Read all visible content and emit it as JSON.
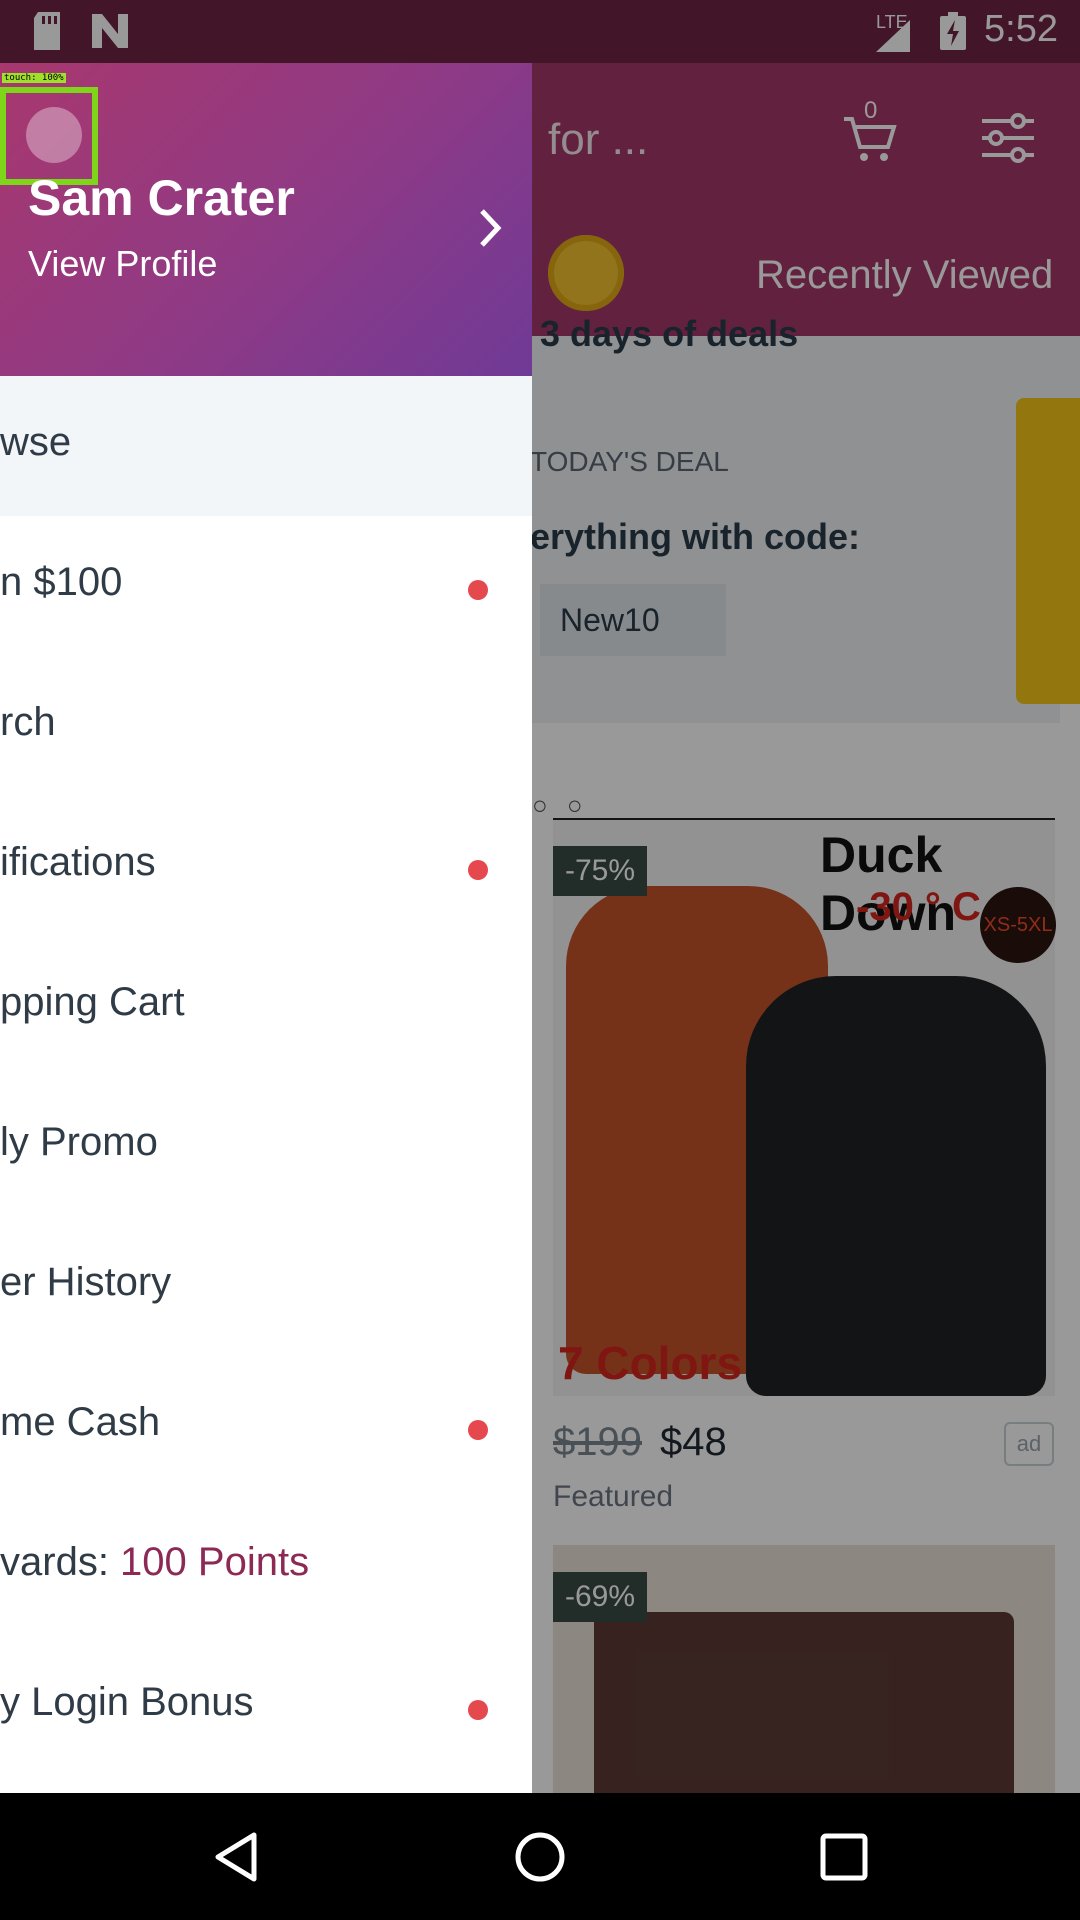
{
  "status_bar": {
    "time": "5:52",
    "network": "LTE"
  },
  "background": {
    "search_placeholder": "for ...",
    "cart_count": "0",
    "recently_viewed": "Recently Viewed",
    "deals_title": "3 days of deals",
    "deal_kicker": "TODAY'S DEAL",
    "deal_text": "erything with code:",
    "deal_code": "New10",
    "product1": {
      "discount": "-75%",
      "brand": "Duck Down",
      "temp": "-30 ° C",
      "size": "XS-5XL",
      "colors": "7 Colors",
      "old_price": "$199",
      "price": "$48",
      "ad": "ad",
      "tag": "Featured"
    },
    "product2": {
      "discount": "-69%"
    }
  },
  "drawer": {
    "user_name": "Sam Crater",
    "view_profile": "View Profile",
    "touch_label": "touch: 100%",
    "items": [
      {
        "label": "wse",
        "dot": false,
        "highlight": true
      },
      {
        "label": "n $100",
        "dot": true
      },
      {
        "label": "rch",
        "dot": false
      },
      {
        "label": "ifications",
        "dot": true
      },
      {
        "label": "pping Cart",
        "dot": false
      },
      {
        "label": "ly Promo",
        "dot": false
      },
      {
        "label": "er History",
        "dot": false
      },
      {
        "label": "me Cash",
        "dot": true
      },
      {
        "label": "vards: ",
        "value": "100 Points",
        "dot": false
      },
      {
        "label": "y Login Bonus",
        "dot": true
      }
    ]
  },
  "colors": {
    "status": "#6e2345",
    "header": "#a6386b",
    "accent": "#8c2955",
    "dot": "#e5484d"
  }
}
